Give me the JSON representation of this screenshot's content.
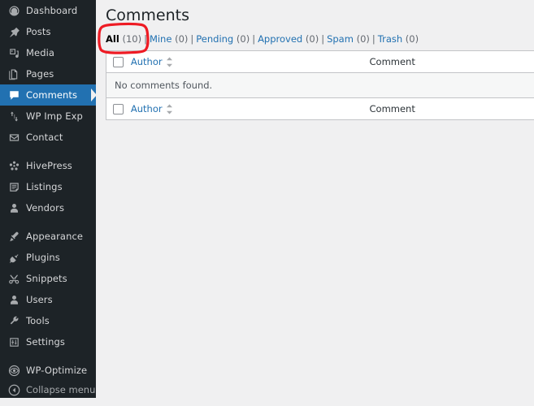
{
  "colors": {
    "sidebar_bg": "#1d2327",
    "sidebar_active": "#2271b1",
    "link": "#2271b1",
    "annotation": "#ee1b24",
    "content_bg": "#f0f0f1",
    "table_bg": "#ffffff",
    "row_alt_bg": "#f6f7f7",
    "border": "#c3c4c7"
  },
  "sidebar": {
    "groups": [
      {
        "items": [
          {
            "label": "Dashboard",
            "icon": "dashboard-icon",
            "active": false
          },
          {
            "label": "Posts",
            "icon": "pin-icon",
            "active": false
          },
          {
            "label": "Media",
            "icon": "media-icon",
            "active": false
          },
          {
            "label": "Pages",
            "icon": "pages-icon",
            "active": false
          },
          {
            "label": "Comments",
            "icon": "comment-bubble-icon",
            "active": true
          },
          {
            "label": "WP Imp Exp",
            "icon": "import-export-icon",
            "active": false
          },
          {
            "label": "Contact",
            "icon": "envelope-icon",
            "active": false
          }
        ]
      },
      {
        "items": [
          {
            "label": "HivePress",
            "icon": "hivepress-icon",
            "active": false
          },
          {
            "label": "Listings",
            "icon": "listings-icon",
            "active": false
          },
          {
            "label": "Vendors",
            "icon": "vendors-icon",
            "active": false
          }
        ]
      },
      {
        "items": [
          {
            "label": "Appearance",
            "icon": "paintbrush-icon",
            "active": false
          },
          {
            "label": "Plugins",
            "icon": "plug-icon",
            "active": false
          },
          {
            "label": "Snippets",
            "icon": "scissors-icon",
            "active": false
          },
          {
            "label": "Users",
            "icon": "user-icon",
            "active": false
          },
          {
            "label": "Tools",
            "icon": "wrench-icon",
            "active": false
          },
          {
            "label": "Settings",
            "icon": "settings-sliders-icon",
            "active": false
          }
        ]
      },
      {
        "items": [
          {
            "label": "WP-Optimize",
            "icon": "eye-icon",
            "active": false
          }
        ]
      }
    ],
    "collapse": {
      "label": "Collapse menu",
      "icon": "collapse-arrow-icon"
    }
  },
  "main": {
    "title": "Comments",
    "filters": [
      {
        "label": "All",
        "count": "(10)",
        "current": true
      },
      {
        "label": "Mine",
        "count": "(0)",
        "current": false
      },
      {
        "label": "Pending",
        "count": "(0)",
        "current": false
      },
      {
        "label": "Approved",
        "count": "(0)",
        "current": false
      },
      {
        "label": "Spam",
        "count": "(0)",
        "current": false
      },
      {
        "label": "Trash",
        "count": "(0)",
        "current": false
      }
    ],
    "filter_divider": "|",
    "table": {
      "columns": {
        "author": "Author",
        "comment": "Comment"
      },
      "empty_message": "No comments found."
    }
  },
  "annotation": {
    "shape": "hand-drawn-rounded-rectangle",
    "target": "All (10)",
    "color": "#ee1b24"
  }
}
